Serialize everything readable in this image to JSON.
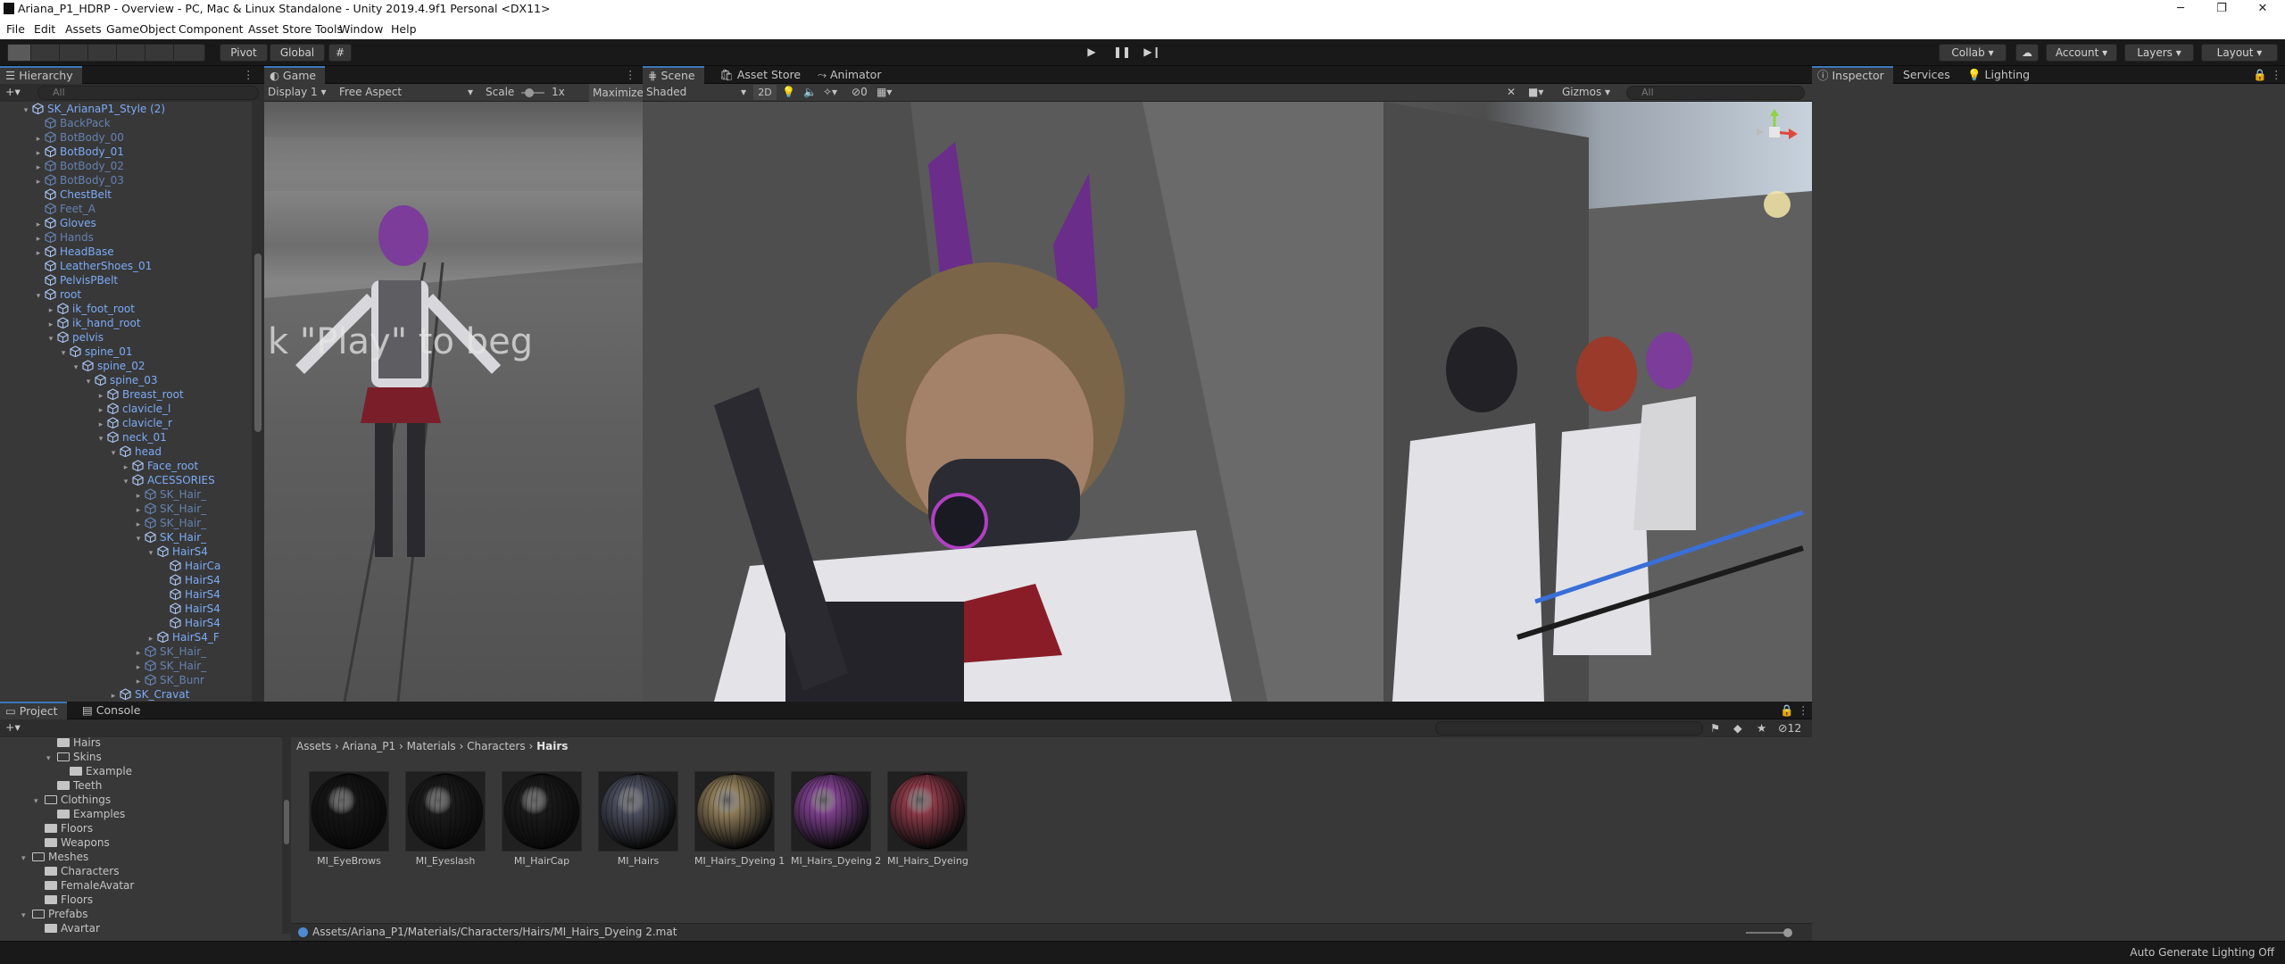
{
  "window": {
    "title": "Ariana_P1_HDRP - Overview - PC, Mac & Linux Standalone - Unity 2019.4.9f1 Personal <DX11>",
    "controls": [
      "─",
      "❐",
      "✕"
    ]
  },
  "menu": [
    "File",
    "Edit",
    "Assets",
    "GameObject",
    "Component",
    "Asset Store Tools",
    "Window",
    "Help"
  ],
  "toolbar": {
    "pivot": "Pivot",
    "global": "Global",
    "collab": "Collab",
    "account": "Account",
    "layers": "Layers",
    "layout": "Layout"
  },
  "hierarchy": {
    "tab": "Hierarchy",
    "search_placeholder": "All",
    "items": [
      {
        "label": "SK_ArianaP1_Style (2)"
      },
      {
        "label": "BackPack"
      },
      {
        "label": "BotBody_00"
      },
      {
        "label": "BotBody_01"
      },
      {
        "label": "BotBody_02"
      },
      {
        "label": "BotBody_03"
      },
      {
        "label": "ChestBelt"
      },
      {
        "label": "Feet_A"
      },
      {
        "label": "Gloves"
      },
      {
        "label": "Hands"
      },
      {
        "label": "HeadBase"
      },
      {
        "label": "LeatherShoes_01"
      },
      {
        "label": "PelvisPBelt"
      },
      {
        "label": "root"
      },
      {
        "label": "ik_foot_root"
      },
      {
        "label": "ik_hand_root"
      },
      {
        "label": "pelvis"
      },
      {
        "label": "spine_01"
      },
      {
        "label": "spine_02"
      },
      {
        "label": "spine_03"
      },
      {
        "label": "Breast_root"
      },
      {
        "label": "clavicle_l"
      },
      {
        "label": "clavicle_r"
      },
      {
        "label": "neck_01"
      },
      {
        "label": "head"
      },
      {
        "label": "Face_root"
      },
      {
        "label": "ACESSORIES"
      },
      {
        "label": "SK_Hair_"
      },
      {
        "label": "SK_Hair_"
      },
      {
        "label": "SK_Hair_"
      },
      {
        "label": "SK_Hair_"
      },
      {
        "label": "HairS4"
      },
      {
        "label": "HairCa"
      },
      {
        "label": "HairS4"
      },
      {
        "label": "HairS4"
      },
      {
        "label": "HairS4"
      },
      {
        "label": "HairS4"
      },
      {
        "label": "HairS4_F"
      },
      {
        "label": "SK_Hair_"
      },
      {
        "label": "SK_Hair_"
      },
      {
        "label": "SK_Bunr"
      },
      {
        "label": "SK_Cravat"
      }
    ]
  },
  "game": {
    "tab": "Game",
    "display": "Display 1",
    "aspect": "Free Aspect",
    "scale_label": "Scale",
    "scale_value": "1x",
    "maximize": "Maximize",
    "overlay_text": "k \"Play\" to beg"
  },
  "scene": {
    "tabs": [
      "Scene",
      "Asset Store",
      "Animator"
    ],
    "shading": "Shaded",
    "mode_2d": "2D",
    "hidden_count": "0",
    "gizmos": "Gizmos",
    "search_placeholder": "All"
  },
  "inspector": {
    "tabs": [
      "Inspector",
      "Services",
      "Lighting"
    ]
  },
  "project": {
    "tabs": [
      "Project",
      "Console"
    ],
    "filter_count": "12",
    "breadcrumb": [
      "Assets",
      "Ariana_P1",
      "Materials",
      "Characters",
      "Hairs"
    ],
    "tree": [
      {
        "label": "Hairs"
      },
      {
        "label": "Skins"
      },
      {
        "label": "Example"
      },
      {
        "label": "Teeth"
      },
      {
        "label": "Clothings"
      },
      {
        "label": "Examples"
      },
      {
        "label": "Floors"
      },
      {
        "label": "Weapons"
      },
      {
        "label": "Meshes"
      },
      {
        "label": "Characters"
      },
      {
        "label": "FemaleAvatar"
      },
      {
        "label": "Floors"
      },
      {
        "label": "Prefabs"
      },
      {
        "label": "Avartar"
      }
    ],
    "assets": [
      {
        "name": "MI_EyeBrows",
        "color": "#151515"
      },
      {
        "name": "MI_Eyeslash",
        "color": "#1a1a1a"
      },
      {
        "name": "MI_HairCap",
        "color": "#1a1a1a"
      },
      {
        "name": "MI_Hairs",
        "color": "#4a4d5c"
      },
      {
        "name": "MI_Hairs_Dyeing 1",
        "color": "#8c7a58"
      },
      {
        "name": "MI_Hairs_Dyeing 2",
        "color": "#7a3f8a"
      },
      {
        "name": "MI_Hairs_Dyeing",
        "color": "#8a3a48"
      }
    ],
    "selected_path": "Assets/Ariana_P1/Materials/Characters/Hairs/MI_Hairs_Dyeing 2.mat"
  },
  "status": {
    "lighting": "Auto Generate Lighting Off"
  }
}
